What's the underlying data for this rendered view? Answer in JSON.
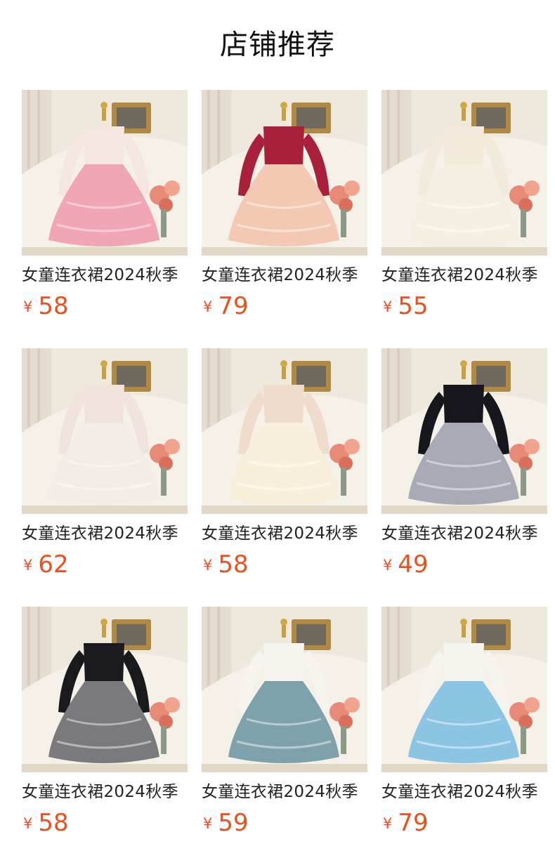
{
  "header": {
    "title": "店铺推荐"
  },
  "currency": "¥",
  "products": [
    {
      "name": "女童连衣裙2024秋季",
      "price": "58",
      "image": "girl-dress-pink-tiered",
      "colors": {
        "top": "#f4e7e0",
        "skirt": "#f0a6b4"
      }
    },
    {
      "name": "女童连衣裙2024秋季",
      "price": "79",
      "image": "girl-dress-red-velvet-peach",
      "colors": {
        "top": "#a8203a",
        "skirt": "#f4c9b4"
      }
    },
    {
      "name": "女童连衣裙2024秋季",
      "price": "55",
      "image": "girl-dress-cream-lace",
      "colors": {
        "top": "#f2ebdc",
        "skirt": "#f6f0e2"
      }
    },
    {
      "name": "女童连衣裙2024秋季",
      "price": "62",
      "image": "girl-dress-ivory-tiered",
      "colors": {
        "top": "#f1e4dc",
        "skirt": "#f4ece6"
      }
    },
    {
      "name": "女童连衣裙2024秋季",
      "price": "58",
      "image": "girl-dress-cream-puff-sleeve",
      "colors": {
        "top": "#f0dccc",
        "skirt": "#f8f0da"
      }
    },
    {
      "name": "女童连衣裙2024秋季",
      "price": "49",
      "image": "girl-dress-black-grey-bow",
      "colors": {
        "top": "#16161c",
        "skirt": "#a8aab6"
      }
    },
    {
      "name": "女童连衣裙2024秋季",
      "price": "58",
      "image": "girl-dress-black-grey-tulle",
      "colors": {
        "top": "#1a1a1e",
        "skirt": "#7a7a7e"
      }
    },
    {
      "name": "女童连衣裙2024秋季",
      "price": "59",
      "image": "girl-dress-teal-smocked",
      "colors": {
        "top": "#f6f4ee",
        "skirt": "#7ea2ac"
      }
    },
    {
      "name": "女童连衣裙2024秋季",
      "price": "79",
      "image": "girl-dress-blue-bow",
      "colors": {
        "top": "#f6f4ee",
        "skirt": "#8cc4e4"
      }
    }
  ]
}
